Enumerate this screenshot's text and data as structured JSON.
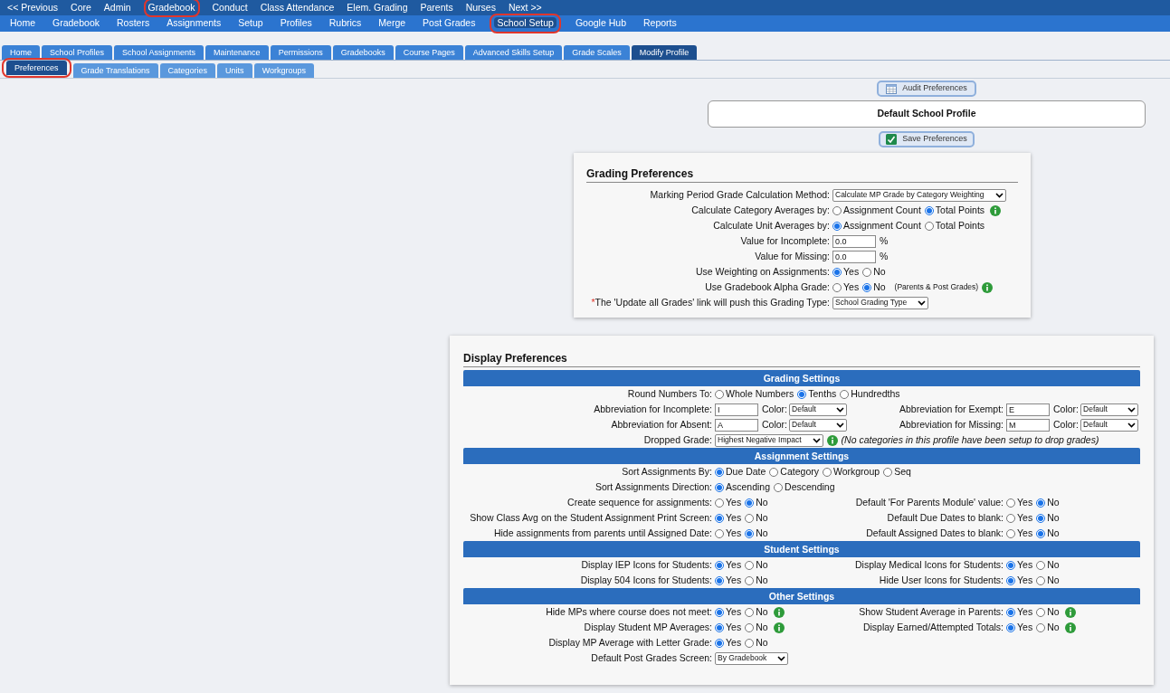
{
  "top_nav": [
    {
      "label": "<< Previous",
      "highlighted": false
    },
    {
      "label": "Core",
      "highlighted": false
    },
    {
      "label": "Admin",
      "highlighted": false
    },
    {
      "label": "Gradebook",
      "highlighted": true
    },
    {
      "label": "Conduct",
      "highlighted": false
    },
    {
      "label": "Class Attendance",
      "highlighted": false
    },
    {
      "label": "Elem. Grading",
      "highlighted": false
    },
    {
      "label": "Parents",
      "highlighted": false
    },
    {
      "label": "Nurses",
      "highlighted": false
    },
    {
      "label": "Next >>",
      "highlighted": false
    }
  ],
  "sub_nav": [
    {
      "label": "Home",
      "selected": false,
      "highlighted": false
    },
    {
      "label": "Gradebook",
      "selected": false,
      "highlighted": false
    },
    {
      "label": "Rosters",
      "selected": false,
      "highlighted": false
    },
    {
      "label": "Assignments",
      "selected": false,
      "highlighted": false
    },
    {
      "label": "Setup",
      "selected": false,
      "highlighted": false
    },
    {
      "label": "Profiles",
      "selected": false,
      "highlighted": false
    },
    {
      "label": "Rubrics",
      "selected": false,
      "highlighted": false
    },
    {
      "label": "Merge",
      "selected": false,
      "highlighted": false
    },
    {
      "label": "Post Grades",
      "selected": false,
      "highlighted": false
    },
    {
      "label": "School Setup",
      "selected": true,
      "highlighted": true
    },
    {
      "label": "Google Hub",
      "selected": false,
      "highlighted": false
    },
    {
      "label": "Reports",
      "selected": false,
      "highlighted": false
    }
  ],
  "tabs": [
    {
      "label": "Home",
      "selected": false
    },
    {
      "label": "School Profiles",
      "selected": false
    },
    {
      "label": "School Assignments",
      "selected": false
    },
    {
      "label": "Maintenance",
      "selected": false
    },
    {
      "label": "Permissions",
      "selected": false
    },
    {
      "label": "Gradebooks",
      "selected": false
    },
    {
      "label": "Course Pages",
      "selected": false
    },
    {
      "label": "Advanced Skills Setup",
      "selected": false
    },
    {
      "label": "Grade Scales",
      "selected": false
    },
    {
      "label": "Modify Profile",
      "selected": true
    }
  ],
  "sub_tabs": [
    {
      "label": "Preferences",
      "selected": true,
      "highlighted": true
    },
    {
      "label": "Grade Translations",
      "selected": false,
      "highlighted": false
    },
    {
      "label": "Categories",
      "selected": false,
      "highlighted": false
    },
    {
      "label": "Units",
      "selected": false,
      "highlighted": false
    },
    {
      "label": "Workgroups",
      "selected": false,
      "highlighted": false
    }
  ],
  "audit_button": "Audit Preferences",
  "profile_title": "Default School Profile",
  "save_button": "Save Preferences",
  "grading_preferences": {
    "title": "Grading Preferences",
    "rows": [
      {
        "label": "Marking Period Grade Calculation Method:",
        "controls": [
          {
            "kind": "select",
            "value": "Calculate MP Grade by Category Weighting"
          }
        ]
      },
      {
        "label": "Calculate Category Averages by:",
        "controls": [
          {
            "kind": "radio",
            "options": [
              {
                "label": "Assignment Count",
                "selected": false
              },
              {
                "label": "Total Points",
                "selected": true
              }
            ]
          },
          {
            "kind": "info"
          }
        ]
      },
      {
        "label": "Calculate Unit Averages by:",
        "controls": [
          {
            "kind": "radio",
            "options": [
              {
                "label": "Assignment Count",
                "selected": true
              },
              {
                "label": "Total Points",
                "selected": false
              }
            ]
          }
        ]
      },
      {
        "label": "Value for Incomplete:",
        "controls": [
          {
            "kind": "input",
            "value": "0.0"
          },
          {
            "kind": "text",
            "text": "%"
          }
        ]
      },
      {
        "label": "Value for Missing:",
        "controls": [
          {
            "kind": "input",
            "value": "0.0"
          },
          {
            "kind": "text",
            "text": "%"
          }
        ]
      },
      {
        "label": "Use Weighting on Assignments:",
        "controls": [
          {
            "kind": "radio",
            "options": [
              {
                "label": "Yes",
                "selected": true
              },
              {
                "label": "No",
                "selected": false
              }
            ]
          }
        ]
      },
      {
        "label": "Use Gradebook Alpha Grade:",
        "controls": [
          {
            "kind": "radio",
            "options": [
              {
                "label": "Yes",
                "selected": false
              },
              {
                "label": "No",
                "selected": true
              }
            ]
          },
          {
            "kind": "small",
            "text": "(Parents & Post Grades)"
          },
          {
            "kind": "info"
          }
        ]
      },
      {
        "label": "The 'Update all Grades' link will push this Grading Type:",
        "marker": "*",
        "controls": [
          {
            "kind": "select",
            "value": "School Grading Type"
          }
        ]
      }
    ]
  },
  "display_preferences": {
    "title": "Display Preferences",
    "sections": [
      {
        "title": "Grading Settings",
        "rows": [
          {
            "left": {
              "label": "Round Numbers To:",
              "controls": [
                {
                  "kind": "radio",
                  "options": [
                    {
                      "label": "Whole Numbers",
                      "selected": false
                    },
                    {
                      "label": "Tenths",
                      "selected": true
                    },
                    {
                      "label": "Hundredths",
                      "selected": false
                    }
                  ]
                }
              ]
            }
          },
          {
            "left": {
              "label": "Abbreviation for Incomplete:",
              "controls": [
                {
                  "kind": "input",
                  "value": "I"
                },
                {
                  "kind": "text",
                  "text": "Color:"
                },
                {
                  "kind": "select",
                  "value": "Default"
                }
              ]
            },
            "right": {
              "label": "Abbreviation for Exempt:",
              "controls": [
                {
                  "kind": "input",
                  "value": "E"
                },
                {
                  "kind": "text",
                  "text": "Color:"
                },
                {
                  "kind": "select",
                  "value": "Default"
                }
              ]
            }
          },
          {
            "left": {
              "label": "Abbreviation for Absent:",
              "controls": [
                {
                  "kind": "input",
                  "value": "A"
                },
                {
                  "kind": "text",
                  "text": "Color:"
                },
                {
                  "kind": "select",
                  "value": "Default"
                }
              ]
            },
            "right": {
              "label": "Abbreviation for Missing:",
              "controls": [
                {
                  "kind": "input",
                  "value": "M"
                },
                {
                  "kind": "text",
                  "text": "Color:"
                },
                {
                  "kind": "select",
                  "value": "Default"
                }
              ]
            }
          },
          {
            "left": {
              "label": "Dropped Grade:",
              "controls": [
                {
                  "kind": "select",
                  "value": "Highest Negative Impact"
                },
                {
                  "kind": "info"
                },
                {
                  "kind": "note",
                  "text": "(No categories in this profile have been setup to drop grades)"
                }
              ]
            }
          }
        ]
      },
      {
        "title": "Assignment Settings",
        "rows": [
          {
            "left": {
              "label": "Sort Assignments By:",
              "controls": [
                {
                  "kind": "radio",
                  "options": [
                    {
                      "label": "Due Date",
                      "selected": true
                    },
                    {
                      "label": "Category",
                      "selected": false
                    },
                    {
                      "label": "Workgroup",
                      "selected": false
                    },
                    {
                      "label": "Seq",
                      "selected": false
                    }
                  ]
                }
              ]
            }
          },
          {
            "left": {
              "label": "Sort Assignments Direction:",
              "controls": [
                {
                  "kind": "radio",
                  "options": [
                    {
                      "label": "Ascending",
                      "selected": true
                    },
                    {
                      "label": "Descending",
                      "selected": false
                    }
                  ]
                }
              ]
            }
          },
          {
            "left": {
              "label": "Create sequence for assignments:",
              "controls": [
                {
                  "kind": "radio",
                  "options": [
                    {
                      "label": "Yes",
                      "selected": false
                    },
                    {
                      "label": "No",
                      "selected": true
                    }
                  ]
                }
              ]
            },
            "right": {
              "label": "Default 'For Parents Module' value:",
              "controls": [
                {
                  "kind": "radio",
                  "options": [
                    {
                      "label": "Yes",
                      "selected": false
                    },
                    {
                      "label": "No",
                      "selected": true
                    }
                  ]
                }
              ]
            }
          },
          {
            "left": {
              "label": "Show Class Avg on the Student Assignment Print Screen:",
              "controls": [
                {
                  "kind": "radio",
                  "options": [
                    {
                      "label": "Yes",
                      "selected": true
                    },
                    {
                      "label": "No",
                      "selected": false
                    }
                  ]
                }
              ]
            },
            "right": {
              "label": "Default Due Dates to blank:",
              "controls": [
                {
                  "kind": "radio",
                  "options": [
                    {
                      "label": "Yes",
                      "selected": false
                    },
                    {
                      "label": "No",
                      "selected": true
                    }
                  ]
                }
              ]
            }
          },
          {
            "left": {
              "label": "Hide assignments from parents until Assigned Date:",
              "controls": [
                {
                  "kind": "radio",
                  "options": [
                    {
                      "label": "Yes",
                      "selected": false
                    },
                    {
                      "label": "No",
                      "selected": true
                    }
                  ]
                }
              ]
            },
            "right": {
              "label": "Default Assigned Dates to blank:",
              "controls": [
                {
                  "kind": "radio",
                  "options": [
                    {
                      "label": "Yes",
                      "selected": false
                    },
                    {
                      "label": "No",
                      "selected": true
                    }
                  ]
                }
              ]
            }
          }
        ]
      },
      {
        "title": "Student Settings",
        "rows": [
          {
            "left": {
              "label": "Display IEP Icons for Students:",
              "controls": [
                {
                  "kind": "radio",
                  "options": [
                    {
                      "label": "Yes",
                      "selected": true
                    },
                    {
                      "label": "No",
                      "selected": false
                    }
                  ]
                }
              ]
            },
            "right": {
              "label": "Display Medical Icons for Students:",
              "controls": [
                {
                  "kind": "radio",
                  "options": [
                    {
                      "label": "Yes",
                      "selected": true
                    },
                    {
                      "label": "No",
                      "selected": false
                    }
                  ]
                }
              ]
            }
          },
          {
            "left": {
              "label": "Display 504 Icons for Students:",
              "controls": [
                {
                  "kind": "radio",
                  "options": [
                    {
                      "label": "Yes",
                      "selected": true
                    },
                    {
                      "label": "No",
                      "selected": false
                    }
                  ]
                }
              ]
            },
            "right": {
              "label": "Hide User Icons for Students:",
              "controls": [
                {
                  "kind": "radio",
                  "options": [
                    {
                      "label": "Yes",
                      "selected": true
                    },
                    {
                      "label": "No",
                      "selected": false
                    }
                  ]
                }
              ]
            }
          }
        ]
      },
      {
        "title": "Other Settings",
        "rows": [
          {
            "left": {
              "label": "Hide MPs where course does not meet:",
              "controls": [
                {
                  "kind": "radio",
                  "options": [
                    {
                      "label": "Yes",
                      "selected": true
                    },
                    {
                      "label": "No",
                      "selected": false
                    }
                  ]
                },
                {
                  "kind": "info"
                }
              ]
            },
            "right": {
              "label": "Show Student Average in Parents:",
              "controls": [
                {
                  "kind": "radio",
                  "options": [
                    {
                      "label": "Yes",
                      "selected": true
                    },
                    {
                      "label": "No",
                      "selected": false
                    }
                  ]
                },
                {
                  "kind": "info"
                }
              ]
            }
          },
          {
            "left": {
              "label": "Display Student MP Averages:",
              "controls": [
                {
                  "kind": "radio",
                  "options": [
                    {
                      "label": "Yes",
                      "selected": true
                    },
                    {
                      "label": "No",
                      "selected": false
                    }
                  ]
                },
                {
                  "kind": "info"
                }
              ]
            },
            "right": {
              "label": "Display Earned/Attempted Totals:",
              "controls": [
                {
                  "kind": "radio",
                  "options": [
                    {
                      "label": "Yes",
                      "selected": true
                    },
                    {
                      "label": "No",
                      "selected": false
                    }
                  ]
                },
                {
                  "kind": "info"
                }
              ]
            }
          },
          {
            "left": {
              "label": "Display MP Average with Letter Grade:",
              "controls": [
                {
                  "kind": "radio",
                  "options": [
                    {
                      "label": "Yes",
                      "selected": true
                    },
                    {
                      "label": "No",
                      "selected": false
                    }
                  ]
                }
              ]
            }
          },
          {
            "left": {
              "label": "Default Post Grades Screen:",
              "controls": [
                {
                  "kind": "select",
                  "value": "By Gradebook"
                }
              ]
            }
          }
        ]
      }
    ]
  }
}
